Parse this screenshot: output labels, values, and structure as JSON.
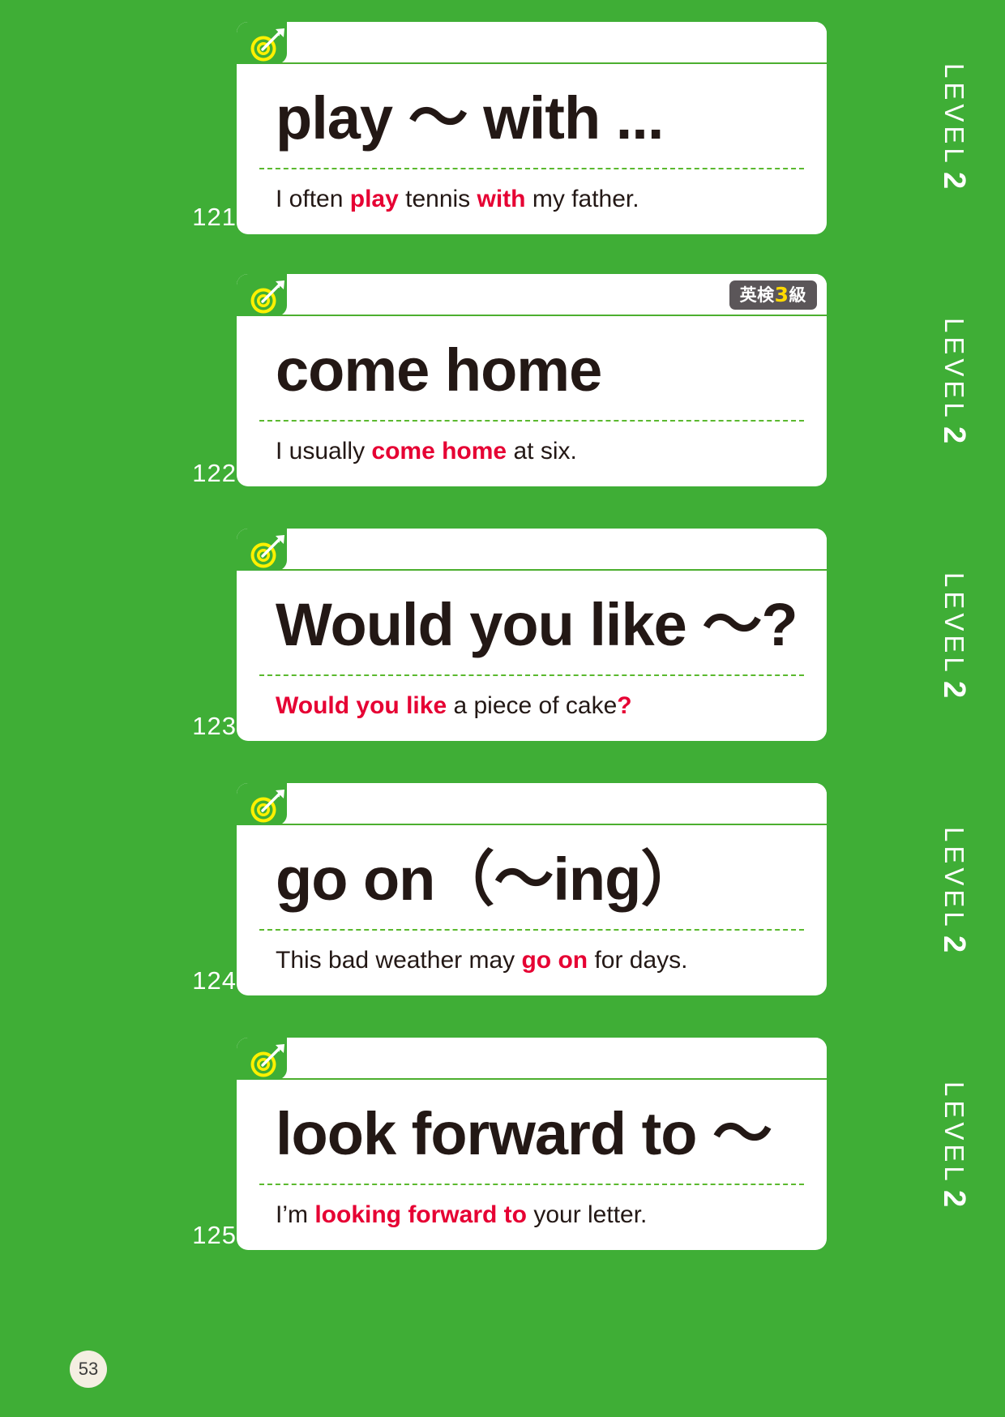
{
  "page": {
    "background_color": "#3FAE36",
    "page_number": "53",
    "level_label": "LEVEL",
    "level_value": "2",
    "accent_red": "#E60033",
    "divider_green": "#5BB92F",
    "badge_bg": "#5B5659",
    "badge_grade_color": "#FFD900"
  },
  "cards": [
    {
      "number": "121",
      "icon": "target-dart-icon",
      "phrase": "play 〜 with ...",
      "badge": null,
      "example_parts": [
        {
          "text": "I",
          "bold": false
        },
        {
          "text": " often ",
          "bold": false
        },
        {
          "text": "play",
          "bold": true
        },
        {
          "text": " tennis ",
          "bold": false
        },
        {
          "text": "with",
          "bold": true
        },
        {
          "text": " my father.",
          "bold": false
        }
      ],
      "example_plain": "I often play tennis with my father.",
      "level": "LEVEL",
      "level_value": "2"
    },
    {
      "number": "122",
      "icon": "target-dart-icon",
      "phrase": "come home",
      "badge": {
        "label": "英検",
        "grade": "3",
        "suffix": "級"
      },
      "example_parts": [
        {
          "text": "I",
          "bold": false
        },
        {
          "text": " usually ",
          "bold": false
        },
        {
          "text": "come home",
          "bold": true
        },
        {
          "text": " at six.",
          "bold": false
        }
      ],
      "example_plain": "I usually come home at six.",
      "level": "LEVEL",
      "level_value": "2"
    },
    {
      "number": "123",
      "icon": "target-dart-icon",
      "phrase": "Would you like 〜?",
      "badge": null,
      "example_parts": [
        {
          "text": "Would you like",
          "bold": true
        },
        {
          "text": " a piece of cake",
          "bold": false
        },
        {
          "text": "?",
          "bold": true
        }
      ],
      "example_plain": "Would you like a piece of cake?",
      "level": "LEVEL",
      "level_value": "2"
    },
    {
      "number": "124",
      "icon": "target-dart-icon",
      "phrase": "go on（〜ing）",
      "badge": null,
      "example_parts": [
        {
          "text": "This bad weather may ",
          "bold": false
        },
        {
          "text": "go on",
          "bold": true
        },
        {
          "text": " for days.",
          "bold": false
        }
      ],
      "example_plain": "This bad weather may go on for days.",
      "level": "LEVEL",
      "level_value": "2"
    },
    {
      "number": "125",
      "icon": "target-dart-icon",
      "phrase": "look forward to 〜",
      "badge": null,
      "example_parts": [
        {
          "text": "I’m ",
          "bold": false
        },
        {
          "text": "looking forward to",
          "bold": true
        },
        {
          "text": " your letter.",
          "bold": false
        }
      ],
      "example_plain": "I’m looking forward to your letter.",
      "level": "LEVEL",
      "level_value": "2"
    }
  ]
}
